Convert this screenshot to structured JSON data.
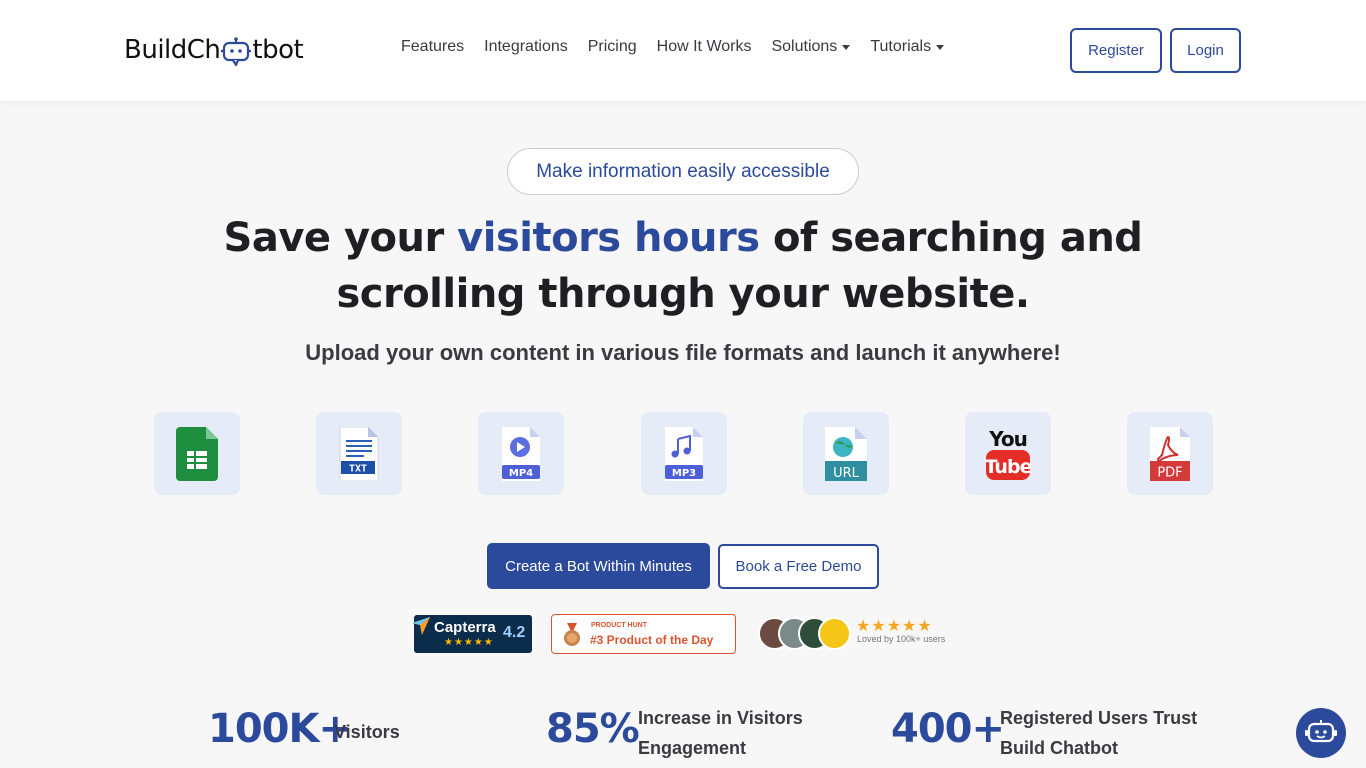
{
  "brand": {
    "logo_text_left": "BuildCh",
    "logo_text_right": "tbot",
    "primary_color": "#2c4a9c"
  },
  "nav": {
    "items": [
      {
        "label": "Features"
      },
      {
        "label": "Integrations"
      },
      {
        "label": "Pricing"
      },
      {
        "label": "How It Works"
      },
      {
        "label": "Solutions"
      },
      {
        "label": "Tutorials"
      }
    ],
    "register_label": "Register",
    "login_label": "Login"
  },
  "hero": {
    "pill": "Make information easily accessible",
    "headline_part1": "Save your ",
    "headline_highlight": "visitors hours",
    "headline_part2": " of searching and",
    "headline_line2": "scrolling through your website.",
    "subheadline": "Upload your own content in various file formats and launch it anywhere!"
  },
  "formats": {
    "txt_label": "TXT",
    "mp4_label": "MP4",
    "mp3_label": "MP3",
    "url_label": "URL",
    "youtube_top": "You",
    "youtube_bottom": "Tube",
    "pdf_label": "PDF"
  },
  "cta": {
    "primary": "Create a Bot Within Minutes",
    "secondary": "Book a Free Demo"
  },
  "badges": {
    "capterra_name": "Capterra",
    "capterra_stars": "★★★★★",
    "capterra_score": "4.2",
    "ph_top": "PRODUCT HUNT",
    "ph_main": "#3 Product of the Day",
    "rating_stars": "★★★★★",
    "loved_text": "Loved by 100k+ users"
  },
  "stats": [
    {
      "value": "100K+",
      "label_line1": "Visitors",
      "label_line2": ""
    },
    {
      "value": "85%",
      "label_line1": "Increase in Visitors",
      "label_line2": "Engagement"
    },
    {
      "value": "400+",
      "label_line1": "Registered Users Trust",
      "label_line2": "Build Chatbot"
    }
  ]
}
